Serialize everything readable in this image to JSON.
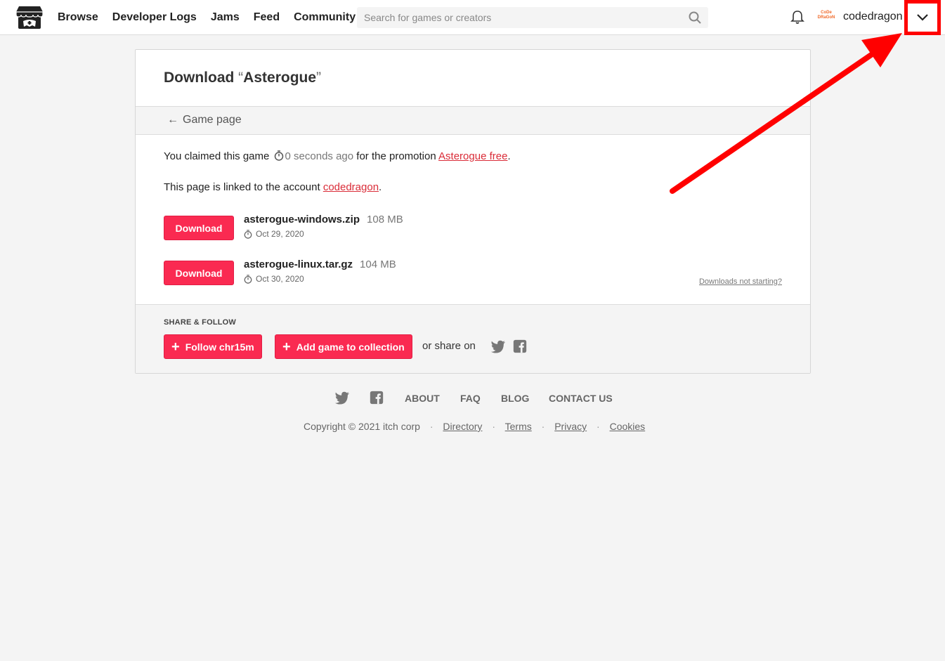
{
  "header": {
    "nav": [
      "Browse",
      "Developer Logs",
      "Jams",
      "Feed",
      "Community"
    ],
    "search_placeholder": "Search for games or creators",
    "avatar_text_1": "CoDe",
    "avatar_text_2": "DRaGoN",
    "username": "codedragon"
  },
  "page": {
    "title_prefix": "Download",
    "title_open_quote": "“",
    "title_game": "Asterogue",
    "title_close_quote": "”",
    "back_link": "Game page",
    "claim_text_1": "You claimed this game",
    "claim_time": "0 seconds ago",
    "claim_text_2": "for the promotion",
    "claim_link": "Asterogue free",
    "claim_end": ".",
    "linked_text": "This page is linked to the account",
    "linked_account": "codedragon",
    "linked_end": ".",
    "files": [
      {
        "button": "Download",
        "name": "asterogue-windows.zip",
        "size": "108 MB",
        "date": "Oct 29, 2020"
      },
      {
        "button": "Download",
        "name": "asterogue-linux.tar.gz",
        "size": "104 MB",
        "date": "Oct 30, 2020"
      }
    ],
    "not_starting": "Downloads not starting?",
    "share_label": "SHARE & FOLLOW",
    "follow_button": "Follow chr15m",
    "collection_button": "Add game to collection",
    "or_share": "or share on"
  },
  "footer": {
    "links": [
      "ABOUT",
      "FAQ",
      "BLOG",
      "CONTACT US"
    ],
    "copyright": "Copyright © 2021 itch corp",
    "legal": [
      "Directory",
      "Terms",
      "Privacy",
      "Cookies"
    ]
  },
  "colors": {
    "accent": "#fa2a51",
    "link": "#da2c38",
    "annotation": "#ff0000"
  }
}
